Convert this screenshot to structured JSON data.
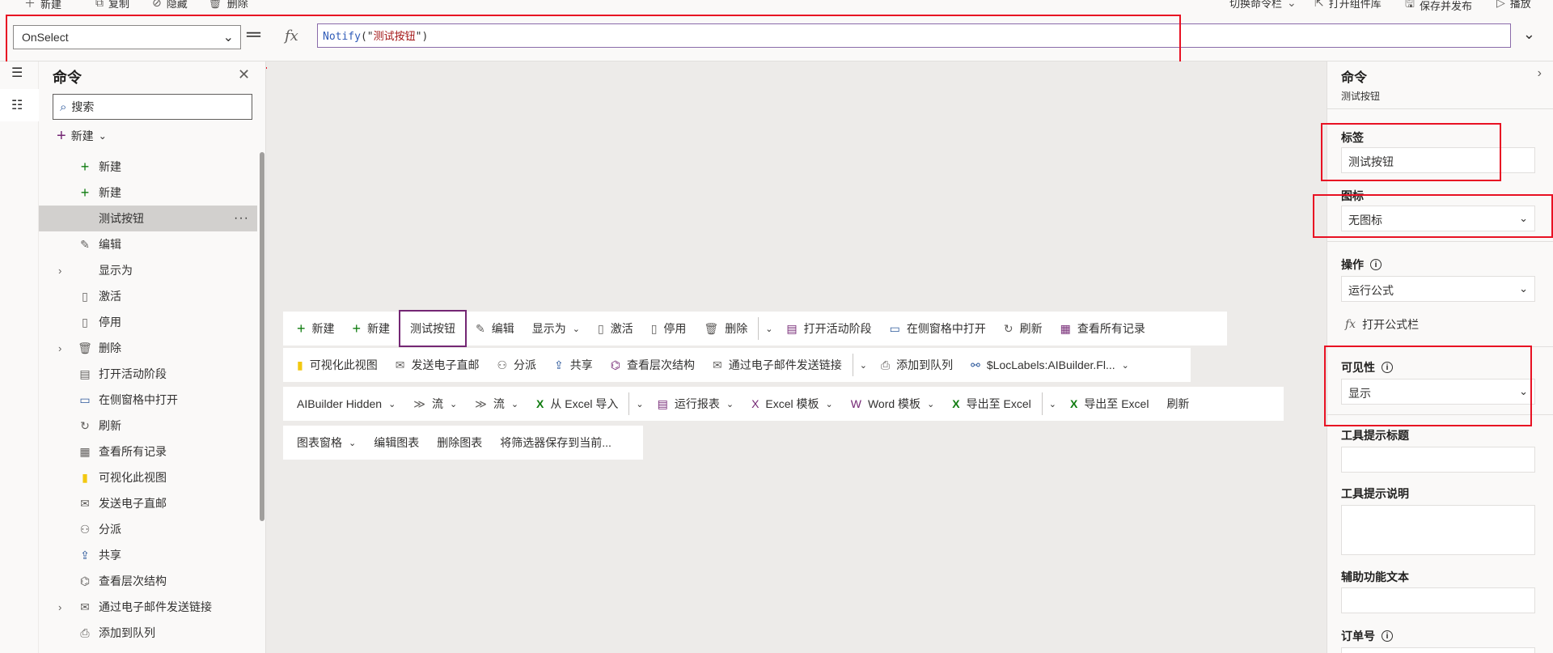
{
  "top_toolbar": {
    "left_items": [
      {
        "icon": "plus-icon",
        "label": "新建"
      },
      {
        "icon": "copy-icon",
        "label": "复制"
      },
      {
        "icon": "hide-icon",
        "label": "隐藏"
      },
      {
        "icon": "delete-icon",
        "label": "删除"
      }
    ],
    "right_items": [
      {
        "icon": "",
        "label": "切换命令栏"
      },
      {
        "icon": "open-library-icon",
        "label": "打开组件库"
      },
      {
        "icon": "save-icon",
        "label": "保存并发布"
      },
      {
        "icon": "play-icon",
        "label": "播放"
      }
    ]
  },
  "formula_bar": {
    "property": "OnSelect",
    "formula_function": "Notify",
    "formula_open": "(\"",
    "formula_string": "测试按钮",
    "formula_close": "\")",
    "fx_label": "fx"
  },
  "command_panel": {
    "title": "命令",
    "search_placeholder": "搜索",
    "new_label": "新建",
    "items": [
      {
        "icon": "plus-icon",
        "label": "新建",
        "expandable": false,
        "selected": false
      },
      {
        "icon": "plus-icon",
        "label": "新建",
        "expandable": false,
        "selected": false
      },
      {
        "icon": "",
        "label": "测试按钮",
        "expandable": false,
        "selected": true
      },
      {
        "icon": "pencil-icon",
        "label": "编辑",
        "expandable": false,
        "selected": false
      },
      {
        "icon": "",
        "label": "显示为",
        "expandable": true,
        "selected": false
      },
      {
        "icon": "activate-icon",
        "label": "激活",
        "expandable": false,
        "selected": false
      },
      {
        "icon": "deactivate-icon",
        "label": "停用",
        "expandable": false,
        "selected": false
      },
      {
        "icon": "delete-icon",
        "label": "删除",
        "expandable": true,
        "selected": false
      },
      {
        "icon": "stage-icon",
        "label": "打开活动阶段",
        "expandable": false,
        "selected": false
      },
      {
        "icon": "side-pane-icon",
        "label": "在侧窗格中打开",
        "expandable": false,
        "selected": false
      },
      {
        "icon": "refresh-icon",
        "label": "刷新",
        "expandable": false,
        "selected": false
      },
      {
        "icon": "grid-icon",
        "label": "查看所有记录",
        "expandable": false,
        "selected": false
      },
      {
        "icon": "powerbi-icon",
        "label": "可视化此视图",
        "expandable": false,
        "selected": false
      },
      {
        "icon": "email-icon",
        "label": "发送电子直邮",
        "expandable": false,
        "selected": false
      },
      {
        "icon": "assign-icon",
        "label": "分派",
        "expandable": false,
        "selected": false
      },
      {
        "icon": "share-icon",
        "label": "共享",
        "expandable": false,
        "selected": false
      },
      {
        "icon": "hierarchy-icon",
        "label": "查看层次结构",
        "expandable": false,
        "selected": false
      },
      {
        "icon": "email-link-icon",
        "label": "通过电子邮件发送链接",
        "expandable": true,
        "selected": false
      },
      {
        "icon": "queue-icon",
        "label": "添加到队列",
        "expandable": false,
        "selected": false
      }
    ]
  },
  "canvas": {
    "row1": [
      {
        "icon": "plus-icon",
        "label": "新建",
        "chevron": false,
        "selected": false
      },
      {
        "icon": "plus-icon",
        "label": "新建",
        "chevron": false,
        "selected": false
      },
      {
        "icon": "",
        "label": "测试按钮",
        "chevron": false,
        "selected": true
      },
      {
        "icon": "pencil-icon",
        "label": "编辑",
        "chevron": false,
        "selected": false
      },
      {
        "icon": "",
        "label": "显示为",
        "chevron": true,
        "selected": false
      },
      {
        "icon": "activate-icon",
        "label": "激活",
        "chevron": false,
        "selected": false
      },
      {
        "icon": "deactivate-icon",
        "label": "停用",
        "chevron": false,
        "selected": false
      },
      {
        "icon": "delete-icon",
        "label": "删除",
        "chevron": false,
        "selected": false
      },
      {
        "icon": "split-chevron",
        "label": "",
        "chevron": false,
        "selected": false
      },
      {
        "icon": "stage-icon",
        "label": "打开活动阶段",
        "chevron": false,
        "selected": false
      },
      {
        "icon": "side-pane-icon",
        "label": "在侧窗格中打开",
        "chevron": false,
        "selected": false
      },
      {
        "icon": "refresh-icon",
        "label": "刷新",
        "chevron": false,
        "selected": false
      },
      {
        "icon": "grid-icon",
        "label": "查看所有记录",
        "chevron": false,
        "selected": false
      }
    ],
    "row2": [
      {
        "icon": "powerbi-icon",
        "label": "可视化此视图",
        "chevron": false
      },
      {
        "icon": "email-icon",
        "label": "发送电子直邮",
        "chevron": false
      },
      {
        "icon": "assign-icon",
        "label": "分派",
        "chevron": false
      },
      {
        "icon": "share-icon",
        "label": "共享",
        "chevron": false
      },
      {
        "icon": "hierarchy-icon",
        "label": "查看层次结构",
        "chevron": false
      },
      {
        "icon": "email-link-icon",
        "label": "通过电子邮件发送链接",
        "chevron": false
      },
      {
        "icon": "split-chevron",
        "label": "",
        "chevron": false
      },
      {
        "icon": "queue-icon",
        "label": "添加到队列",
        "chevron": false
      },
      {
        "icon": "ai-icon",
        "label": "$LocLabels:AIBuilder.Fl...",
        "chevron": true
      }
    ],
    "row3": [
      {
        "icon": "",
        "label": "AIBuilder Hidden",
        "chevron": true
      },
      {
        "icon": "flow-icon",
        "label": "流",
        "chevron": true
      },
      {
        "icon": "flow-icon",
        "label": "流",
        "chevron": true
      },
      {
        "icon": "excel-icon",
        "label": "从 Excel 导入",
        "chevron": false
      },
      {
        "icon": "split-chevron",
        "label": "",
        "chevron": false
      },
      {
        "icon": "report-icon",
        "label": "运行报表",
        "chevron": true
      },
      {
        "icon": "excel-icon",
        "label": "Excel 模板",
        "chevron": true
      },
      {
        "icon": "word-icon",
        "label": "Word 模板",
        "chevron": true
      },
      {
        "icon": "excel-icon",
        "label": "导出至 Excel",
        "chevron": false
      },
      {
        "icon": "split-chevron",
        "label": "",
        "chevron": false
      },
      {
        "icon": "excel-icon",
        "label": "导出至 Excel",
        "chevron": false
      },
      {
        "icon": "",
        "label": "刷新",
        "chevron": false
      }
    ],
    "row4": [
      {
        "icon": "",
        "label": "图表窗格",
        "chevron": true
      },
      {
        "icon": "",
        "label": "编辑图表",
        "chevron": false
      },
      {
        "icon": "",
        "label": "删除图表",
        "chevron": false
      },
      {
        "icon": "",
        "label": "将筛选器保存到当前...",
        "chevron": false
      }
    ]
  },
  "properties": {
    "title": "命令",
    "subtitle": "测试按钮",
    "label_heading": "标签",
    "label_value": "测试按钮",
    "icon_heading": "图标",
    "icon_value": "无图标",
    "action_heading": "操作",
    "action_value": "运行公式",
    "open_formula_bar": "打开公式栏",
    "visibility_heading": "可见性",
    "visibility_value": "显示",
    "tooltip_title_heading": "工具提示标题",
    "tooltip_desc_heading": "工具提示说明",
    "accessibility_heading": "辅助功能文本",
    "order_heading": "订单号"
  },
  "colors": {
    "accent": "#742774",
    "highlight_box": "#e81123",
    "formula_function": "#2f5bb7",
    "formula_string": "#a31515"
  }
}
